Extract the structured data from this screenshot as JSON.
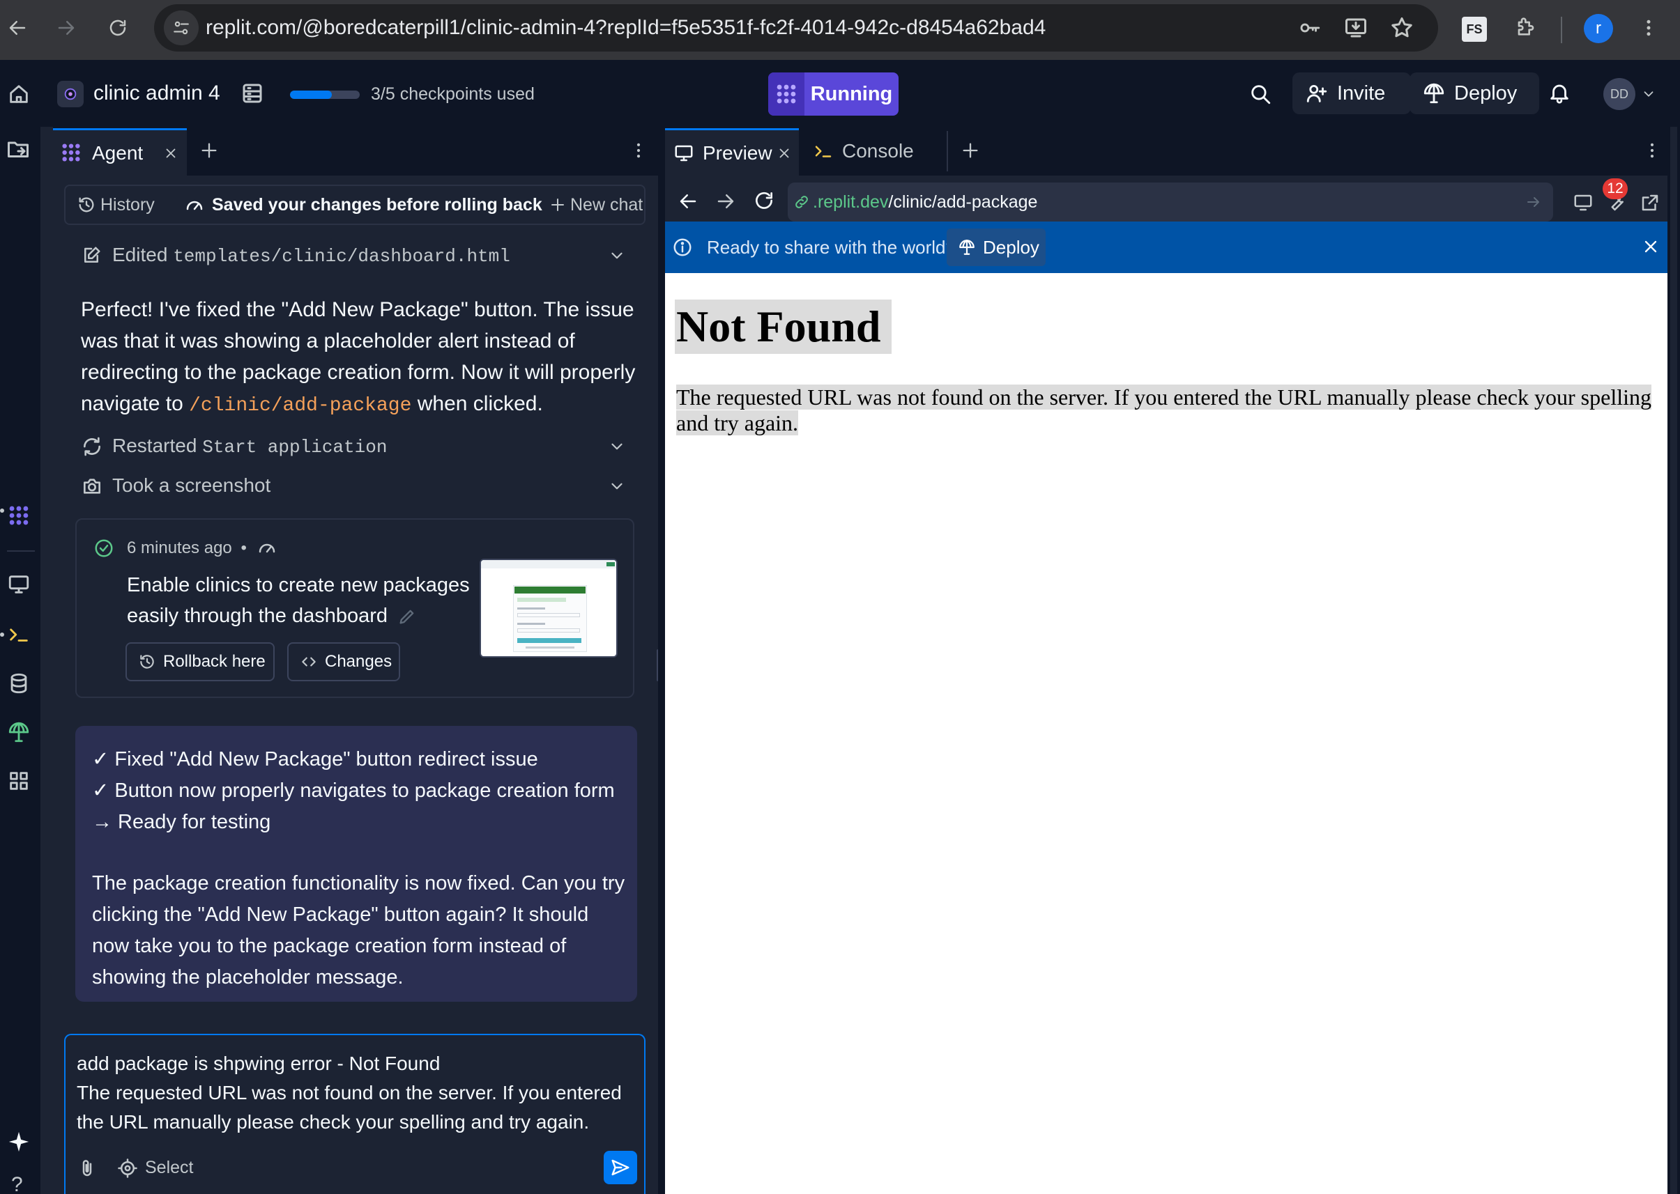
{
  "browser": {
    "url": "replit.com/@boredcaterpill1/clinic-admin-4?replId=f5e5351f-fc2f-4014-942c-d8454a62bad4",
    "ext_label": "FS",
    "profile_initial": "r"
  },
  "header": {
    "project_name": "clinic admin 4",
    "checkpoints": "3/5 checkpoints used",
    "checkpoints_progress": 0.6,
    "run_label": "Running",
    "invite_label": "Invite",
    "deploy_label": "Deploy",
    "avatar_initials": "DD"
  },
  "agent": {
    "tab_label": "Agent",
    "history_label": "History",
    "status_text": "Saved your changes before rolling back",
    "new_chat_label": "New chat",
    "edited_prefix": "Edited",
    "edited_file": "templates/clinic/dashboard.html",
    "message_1_part1": "Perfect! I've fixed the \"Add New Package\" button. The issue was that it was showing a placeholder alert instead of redirecting to the package creation form. Now it will properly navigate to ",
    "message_1_code": "/clinic/add-package",
    "message_1_part2": " when clicked.",
    "restarted_prefix": "Restarted",
    "restarted_name": "Start application",
    "screenshot_label": "Took a screenshot",
    "checkpoint": {
      "time": "6 minutes ago",
      "sep": "•",
      "description": "Enable clinics to create new packages easily through the dashboard",
      "rollback_label": "Rollback here",
      "changes_label": "Changes"
    },
    "summary": {
      "items": [
        "✓ Fixed \"Add New Package\" button redirect issue",
        "✓ Button now properly navigates to package creation form",
        "→ Ready for testing"
      ],
      "paragraph": "The package creation functionality is now fixed. Can you try clicking the \"Add New Package\" button again? It should now take you to the package creation form instead of showing the placeholder message."
    },
    "input": {
      "line1": "add package is shpwing error - Not Found",
      "line2": "The requested URL was not found on the server. If you entered the URL manually please check your spelling and try again.",
      "select_label": "Select"
    }
  },
  "preview": {
    "tab_preview": "Preview",
    "tab_console": "Console",
    "url_domain": ".replit.dev",
    "url_path": "/clinic/add-package",
    "badge_count": "12",
    "banner_text": "Ready to share with the world?",
    "banner_deploy": "Deploy",
    "page_title": "Not Found",
    "page_text": "The requested URL was not found on the server. If you entered the URL manually please check your spelling and try again."
  },
  "colors": {
    "accent": "#5240d6",
    "run_badge": "#5a47d9",
    "progress": "#0079f2",
    "banner": "#0053a6",
    "code": "#f5a15a",
    "domain_green": "#5cc88a",
    "send": "#0079f2",
    "notif": "#e53935"
  }
}
